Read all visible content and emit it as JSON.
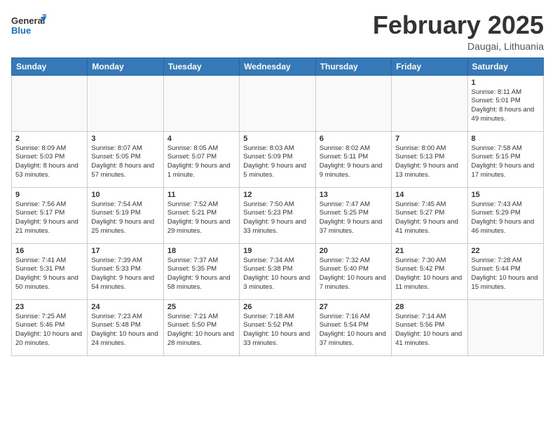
{
  "header": {
    "logo_general": "General",
    "logo_blue": "Blue",
    "month_title": "February 2025",
    "location": "Daugai, Lithuania"
  },
  "days_of_week": [
    "Sunday",
    "Monday",
    "Tuesday",
    "Wednesday",
    "Thursday",
    "Friday",
    "Saturday"
  ],
  "weeks": [
    [
      {
        "day": "",
        "info": ""
      },
      {
        "day": "",
        "info": ""
      },
      {
        "day": "",
        "info": ""
      },
      {
        "day": "",
        "info": ""
      },
      {
        "day": "",
        "info": ""
      },
      {
        "day": "",
        "info": ""
      },
      {
        "day": "1",
        "info": "Sunrise: 8:11 AM\nSunset: 5:01 PM\nDaylight: 8 hours and 49 minutes."
      }
    ],
    [
      {
        "day": "2",
        "info": "Sunrise: 8:09 AM\nSunset: 5:03 PM\nDaylight: 8 hours and 53 minutes."
      },
      {
        "day": "3",
        "info": "Sunrise: 8:07 AM\nSunset: 5:05 PM\nDaylight: 8 hours and 57 minutes."
      },
      {
        "day": "4",
        "info": "Sunrise: 8:05 AM\nSunset: 5:07 PM\nDaylight: 9 hours and 1 minute."
      },
      {
        "day": "5",
        "info": "Sunrise: 8:03 AM\nSunset: 5:09 PM\nDaylight: 9 hours and 5 minutes."
      },
      {
        "day": "6",
        "info": "Sunrise: 8:02 AM\nSunset: 5:11 PM\nDaylight: 9 hours and 9 minutes."
      },
      {
        "day": "7",
        "info": "Sunrise: 8:00 AM\nSunset: 5:13 PM\nDaylight: 9 hours and 13 minutes."
      },
      {
        "day": "8",
        "info": "Sunrise: 7:58 AM\nSunset: 5:15 PM\nDaylight: 9 hours and 17 minutes."
      }
    ],
    [
      {
        "day": "9",
        "info": "Sunrise: 7:56 AM\nSunset: 5:17 PM\nDaylight: 9 hours and 21 minutes."
      },
      {
        "day": "10",
        "info": "Sunrise: 7:54 AM\nSunset: 5:19 PM\nDaylight: 9 hours and 25 minutes."
      },
      {
        "day": "11",
        "info": "Sunrise: 7:52 AM\nSunset: 5:21 PM\nDaylight: 9 hours and 29 minutes."
      },
      {
        "day": "12",
        "info": "Sunrise: 7:50 AM\nSunset: 5:23 PM\nDaylight: 9 hours and 33 minutes."
      },
      {
        "day": "13",
        "info": "Sunrise: 7:47 AM\nSunset: 5:25 PM\nDaylight: 9 hours and 37 minutes."
      },
      {
        "day": "14",
        "info": "Sunrise: 7:45 AM\nSunset: 5:27 PM\nDaylight: 9 hours and 41 minutes."
      },
      {
        "day": "15",
        "info": "Sunrise: 7:43 AM\nSunset: 5:29 PM\nDaylight: 9 hours and 46 minutes."
      }
    ],
    [
      {
        "day": "16",
        "info": "Sunrise: 7:41 AM\nSunset: 5:31 PM\nDaylight: 9 hours and 50 minutes."
      },
      {
        "day": "17",
        "info": "Sunrise: 7:39 AM\nSunset: 5:33 PM\nDaylight: 9 hours and 54 minutes."
      },
      {
        "day": "18",
        "info": "Sunrise: 7:37 AM\nSunset: 5:35 PM\nDaylight: 9 hours and 58 minutes."
      },
      {
        "day": "19",
        "info": "Sunrise: 7:34 AM\nSunset: 5:38 PM\nDaylight: 10 hours and 3 minutes."
      },
      {
        "day": "20",
        "info": "Sunrise: 7:32 AM\nSunset: 5:40 PM\nDaylight: 10 hours and 7 minutes."
      },
      {
        "day": "21",
        "info": "Sunrise: 7:30 AM\nSunset: 5:42 PM\nDaylight: 10 hours and 11 minutes."
      },
      {
        "day": "22",
        "info": "Sunrise: 7:28 AM\nSunset: 5:44 PM\nDaylight: 10 hours and 15 minutes."
      }
    ],
    [
      {
        "day": "23",
        "info": "Sunrise: 7:25 AM\nSunset: 5:46 PM\nDaylight: 10 hours and 20 minutes."
      },
      {
        "day": "24",
        "info": "Sunrise: 7:23 AM\nSunset: 5:48 PM\nDaylight: 10 hours and 24 minutes."
      },
      {
        "day": "25",
        "info": "Sunrise: 7:21 AM\nSunset: 5:50 PM\nDaylight: 10 hours and 28 minutes."
      },
      {
        "day": "26",
        "info": "Sunrise: 7:18 AM\nSunset: 5:52 PM\nDaylight: 10 hours and 33 minutes."
      },
      {
        "day": "27",
        "info": "Sunrise: 7:16 AM\nSunset: 5:54 PM\nDaylight: 10 hours and 37 minutes."
      },
      {
        "day": "28",
        "info": "Sunrise: 7:14 AM\nSunset: 5:56 PM\nDaylight: 10 hours and 41 minutes."
      },
      {
        "day": "",
        "info": ""
      }
    ]
  ]
}
